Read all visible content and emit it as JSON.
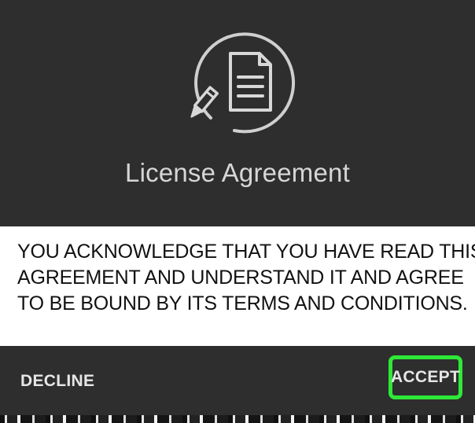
{
  "header": {
    "title": "License Agreement",
    "icon": "document-pencil-icon"
  },
  "agreement": {
    "lines": [
      "YOU ACKNOWLEDGE THAT YOU HAVE READ THIS",
      "AGREEMENT AND UNDERSTAND IT AND AGREE",
      "TO BE BOUND BY ITS TERMS AND CONDITIONS."
    ]
  },
  "footer": {
    "decline_label": "DECLINE",
    "accept_label": "ACCEPT"
  },
  "colors": {
    "background_dark": "#2e2e2e",
    "highlight_green": "#2ee838",
    "text_light": "#d6d6d6"
  }
}
